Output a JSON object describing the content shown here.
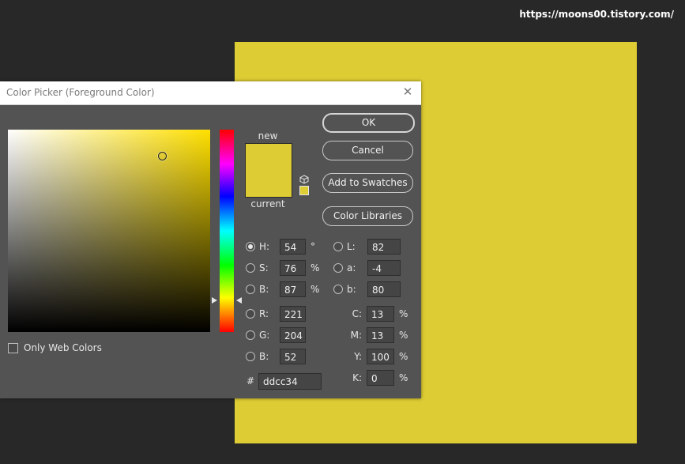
{
  "watermark": "https://moons00.tistory.com/",
  "dialog": {
    "title": "Color Picker (Foreground Color)",
    "close_icon": "close-icon",
    "only_web_colors_label": "Only Web Colors",
    "only_web_colors_checked": false,
    "new_label": "new",
    "current_label": "current",
    "new_color": "#ddcc34",
    "current_color": "#ddcc34",
    "buttons": {
      "ok": "OK",
      "cancel": "Cancel",
      "add_to_swatches": "Add to Swatches",
      "color_libraries": "Color Libraries"
    },
    "hsb": {
      "h": {
        "label": "H:",
        "value": "54",
        "unit": "°",
        "selected": true
      },
      "s": {
        "label": "S:",
        "value": "76",
        "unit": "%"
      },
      "b": {
        "label": "B:",
        "value": "87",
        "unit": "%"
      }
    },
    "rgb": {
      "r": {
        "label": "R:",
        "value": "221"
      },
      "g": {
        "label": "G:",
        "value": "204"
      },
      "b": {
        "label": "B:",
        "value": "52"
      }
    },
    "lab": {
      "l": {
        "label": "L:",
        "value": "82"
      },
      "a": {
        "label": "a:",
        "value": "-4"
      },
      "b": {
        "label": "b:",
        "value": "80"
      }
    },
    "cmyk": {
      "c": {
        "label": "C:",
        "value": "13",
        "unit": "%"
      },
      "m": {
        "label": "M:",
        "value": "13",
        "unit": "%"
      },
      "y": {
        "label": "Y:",
        "value": "100",
        "unit": "%"
      },
      "k": {
        "label": "K:",
        "value": "0",
        "unit": "%"
      }
    },
    "hex": {
      "label": "#",
      "value": "ddcc34"
    }
  },
  "colors": {
    "document_fill": "#ddcc34",
    "dialog_bg": "#535353",
    "app_bg": "#282828"
  }
}
